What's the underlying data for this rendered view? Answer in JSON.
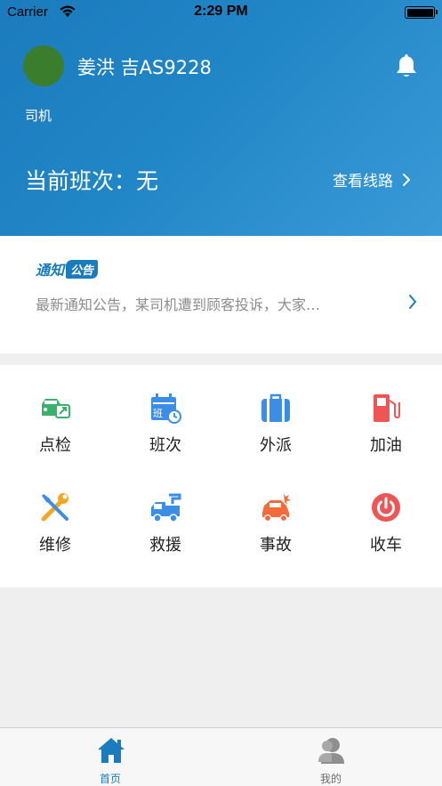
{
  "status_bar": {
    "carrier": "Carrier",
    "time": "2:29 PM"
  },
  "header": {
    "username": "姜洪 吉AS9228",
    "role": "司机",
    "shift": "当前班次：无",
    "route_link": "查看线路"
  },
  "notice": {
    "logo_part1": "通知",
    "logo_part2": "公告",
    "message": "最新通知公告，某司机遭到顾客投诉，大家…"
  },
  "menu": [
    {
      "label": "点检",
      "icon": "car-inspection-icon"
    },
    {
      "label": "班次",
      "icon": "shift-calendar-icon"
    },
    {
      "label": "外派",
      "icon": "briefcase-icon"
    },
    {
      "label": "加油",
      "icon": "fuel-pump-icon"
    },
    {
      "label": "维修",
      "icon": "repair-tools-icon"
    },
    {
      "label": "救援",
      "icon": "tow-truck-icon"
    },
    {
      "label": "事故",
      "icon": "car-accident-icon"
    },
    {
      "label": "收车",
      "icon": "power-icon"
    }
  ],
  "tabs": [
    {
      "label": "首页",
      "icon": "home-icon",
      "active": true
    },
    {
      "label": "我的",
      "icon": "profile-icon",
      "active": false
    }
  ],
  "colors": {
    "primary": "#1a7bbd",
    "green": "#3ab26b",
    "blue": "#3a8ee6",
    "red": "#f05555",
    "orange": "#f5a623",
    "tab_inactive": "#8e8e8e"
  }
}
